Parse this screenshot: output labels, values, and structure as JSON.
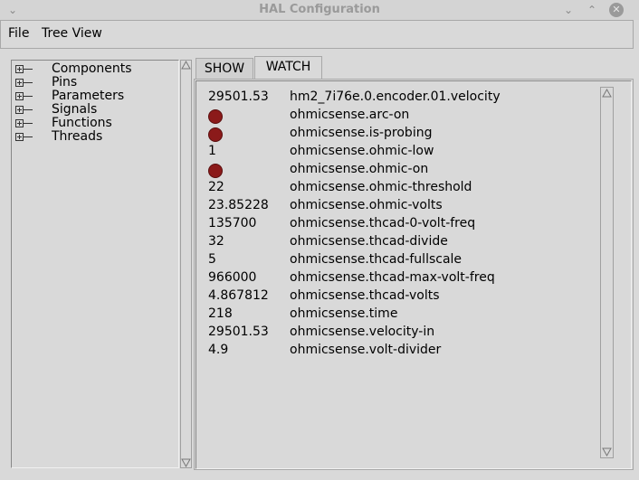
{
  "window": {
    "title": "HAL Configuration"
  },
  "menu": {
    "file": "File",
    "tree_view": "Tree View"
  },
  "tree": {
    "items": [
      {
        "label": "Components"
      },
      {
        "label": "Pins"
      },
      {
        "label": "Parameters"
      },
      {
        "label": "Signals"
      },
      {
        "label": "Functions"
      },
      {
        "label": "Threads"
      }
    ]
  },
  "tabs": {
    "show": "SHOW",
    "watch": "WATCH",
    "active": "WATCH"
  },
  "watch": {
    "rows": [
      {
        "value": "29501.53",
        "name": "hm2_7i76e.0.encoder.01.velocity",
        "led": false
      },
      {
        "value": "",
        "name": "ohmicsense.arc-on",
        "led": true
      },
      {
        "value": "",
        "name": "ohmicsense.is-probing",
        "led": true
      },
      {
        "value": "1",
        "name": "ohmicsense.ohmic-low",
        "led": false
      },
      {
        "value": "",
        "name": "ohmicsense.ohmic-on",
        "led": true
      },
      {
        "value": "22",
        "name": "ohmicsense.ohmic-threshold",
        "led": false
      },
      {
        "value": "23.85228",
        "name": "ohmicsense.ohmic-volts",
        "led": false
      },
      {
        "value": "135700",
        "name": "ohmicsense.thcad-0-volt-freq",
        "led": false
      },
      {
        "value": "32",
        "name": "ohmicsense.thcad-divide",
        "led": false
      },
      {
        "value": "5",
        "name": "ohmicsense.thcad-fullscale",
        "led": false
      },
      {
        "value": "966000",
        "name": "ohmicsense.thcad-max-volt-freq",
        "led": false
      },
      {
        "value": "4.867812",
        "name": "ohmicsense.thcad-volts",
        "led": false
      },
      {
        "value": "218",
        "name": "ohmicsense.time",
        "led": false
      },
      {
        "value": "29501.53",
        "name": "ohmicsense.velocity-in",
        "led": false
      },
      {
        "value": "4.9",
        "name": "ohmicsense.volt-divider",
        "led": false
      }
    ],
    "led_color": "#8b1a1a"
  }
}
